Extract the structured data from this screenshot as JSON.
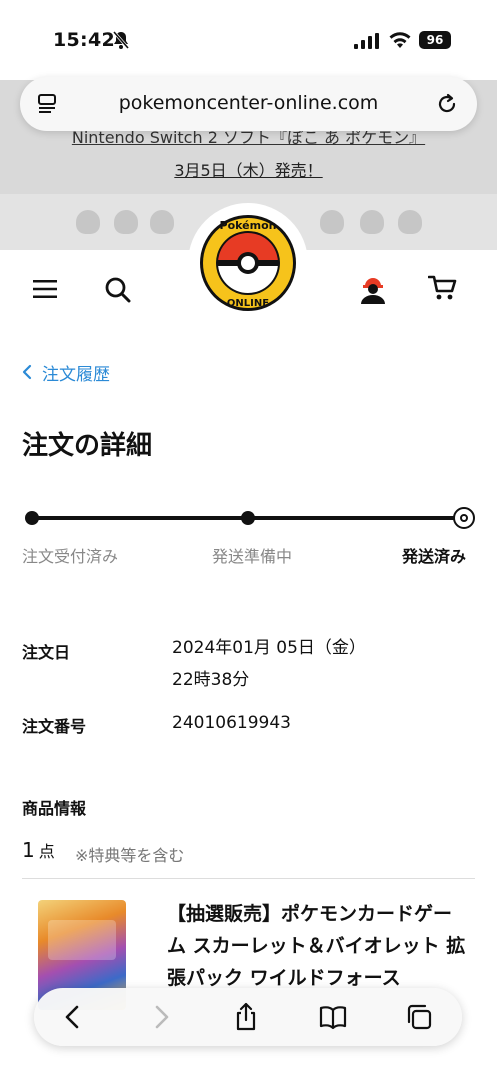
{
  "status_bar": {
    "time": "15:42",
    "battery": "96",
    "icons": [
      "bell-slash-icon",
      "signal-icon",
      "wifi-icon",
      "battery-icon"
    ]
  },
  "browser": {
    "url": "pokemoncenter-online.com",
    "reader_icon": "reader-mode-icon",
    "reload_icon": "reload-icon",
    "toolbar_icons": [
      "back-icon",
      "forward-icon",
      "share-icon",
      "bookmarks-icon",
      "tabs-icon"
    ]
  },
  "banner": {
    "line1": "Nintendo Switch 2 ソフト『ぽこ あ ポケモン』",
    "line2": "3月5日（木）発売！"
  },
  "header": {
    "logo_text": "Pokémon Center ONLINE",
    "icons": [
      "menu-icon",
      "search-icon",
      "account-icon",
      "cart-icon"
    ]
  },
  "breadcrumb": {
    "back_label": "注文履歴"
  },
  "page_title": "注文の詳細",
  "progress": {
    "steps": [
      "注文受付済み",
      "発送準備中",
      "発送済み"
    ],
    "current_step": 3
  },
  "order": {
    "date_label": "注文日",
    "date_value_line1": "2024年01月 05日（金）",
    "date_value_line2": "22時38分",
    "number_label": "注文番号",
    "number_value": "24010619943"
  },
  "products": {
    "section_label": "商品情報",
    "count": "1",
    "count_unit": "点",
    "note": "※特典等を含む",
    "items": [
      {
        "title": "【抽選販売】ポケモンカードゲーム スカーレット＆バイオレット 拡張パック ワイルドフォース"
      }
    ]
  },
  "colors": {
    "link": "#2b8ad6",
    "banner_bg": "#d9d9d9",
    "text": "#111111"
  }
}
